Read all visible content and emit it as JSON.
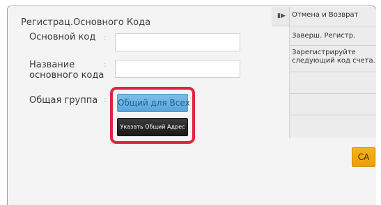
{
  "form": {
    "title": "Регистрац.Основного Кода",
    "fields": [
      {
        "label": "Основной код",
        "colon": ":",
        "value": ""
      },
      {
        "label": "Название основного кода",
        "colon": ":",
        "value": ""
      }
    ],
    "common_group": {
      "label": "Общая группа",
      "colon": ":",
      "common_all_button": "Общий для Всех",
      "common_address_button": "Указать Общий Адрес"
    }
  },
  "side_panel": {
    "arrow_icon": "play-pause-icon",
    "items": [
      "Отмена и Возврат",
      "Заверш. Регистр.",
      "Зарегистрируйте следующий код счета.",
      "",
      "",
      ""
    ],
    "ca_button": "CA"
  },
  "colors": {
    "highlight": "#e0243f",
    "primary_button": "#6aaee2",
    "ca_button": "#f2a80e"
  }
}
